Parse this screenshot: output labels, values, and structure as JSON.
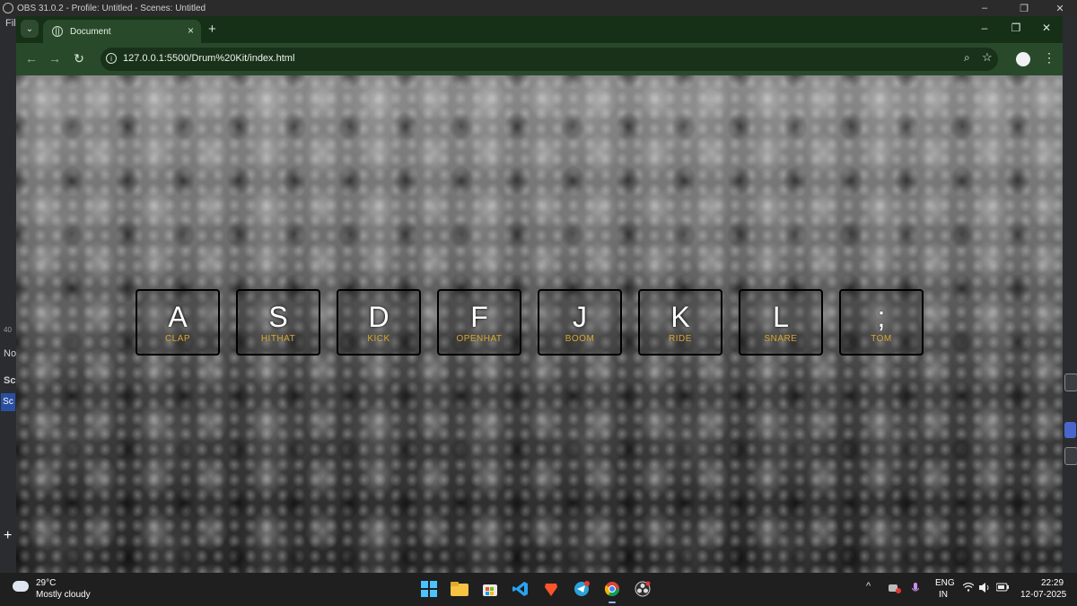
{
  "obs": {
    "title": "OBS 31.0.2 - Profile: Untitled - Scenes: Untitled",
    "left_fragments": [
      "Fil",
      "40",
      "No",
      "Sc",
      "Sc",
      "+"
    ],
    "controls": [
      "–",
      "❐",
      "✕"
    ]
  },
  "browser": {
    "tab_title": "Document",
    "tab_close": "×",
    "new_tab": "+",
    "url": "127.0.0.1:5500/Drum%20Kit/index.html",
    "window_controls": [
      "–",
      "❐",
      "✕"
    ]
  },
  "drums": [
    {
      "key": "A",
      "sound": "CLAP"
    },
    {
      "key": "S",
      "sound": "HITHAT"
    },
    {
      "key": "D",
      "sound": "KICK"
    },
    {
      "key": "F",
      "sound": "OPENHAT"
    },
    {
      "key": "J",
      "sound": "BOOM"
    },
    {
      "key": "K",
      "sound": "RIDE"
    },
    {
      "key": "L",
      "sound": "SNARE"
    },
    {
      "key": ";",
      "sound": "TOM"
    }
  ],
  "taskbar": {
    "weather_temp": "29°C",
    "weather_desc": "Mostly cloudy",
    "lang_primary": "ENG",
    "lang_secondary": "IN",
    "time": "22:29",
    "date": "12-07-2025"
  }
}
